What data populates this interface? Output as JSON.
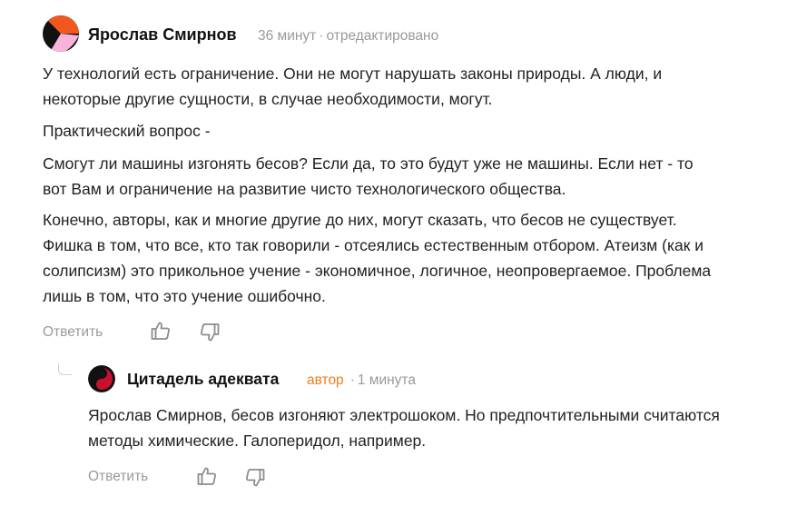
{
  "comment": {
    "author": "Ярослав Смирнов",
    "time": "36 минут",
    "edited": "отредактировано",
    "separator": "·",
    "paragraphs": [
      "У технологий есть ограничение. Они не могут нарушать законы природы. А люди, и некоторые другие сущности, в случае необходимости, могут.",
      "Практический вопрос -",
      "Смогут ли машины изгонять бесов? Если да, то это будут уже не машины. Если нет - то вот Вам и ограничение на развитие чисто технологического общества.",
      "Конечно, авторы, как и многие другие до них, могут сказать, что бесов не существует. Фишка в том, что все, кто так говорили - отсеялись естественным отбором. Атеизм (как и солипсизм) это прикольное учение - экономичное, логичное, неопровергаемое. Проблема лишь в том, что это учение ошибочно."
    ],
    "reply_label": "Ответить",
    "like_icon": "thumbs-up-icon",
    "dislike_icon": "thumbs-down-icon"
  },
  "reply": {
    "author": "Цитадель адеквата",
    "badge": "автор",
    "separator": "·",
    "time": "1 минута",
    "text": "Ярослав Смирнов, бесов изгоняют электрошоком. Но предпочтительными считаются методы химические. Галоперидол, например.",
    "reply_label": "Ответить",
    "like_icon": "thumbs-up-icon",
    "dislike_icon": "thumbs-down-icon"
  },
  "colors": {
    "text": "#222222",
    "muted": "#9a9a9a",
    "author_badge": "#f07d1a",
    "avatar_orange": "#f2571d",
    "avatar_pink": "#f7b3d9",
    "avatar_red": "#c8102e"
  }
}
